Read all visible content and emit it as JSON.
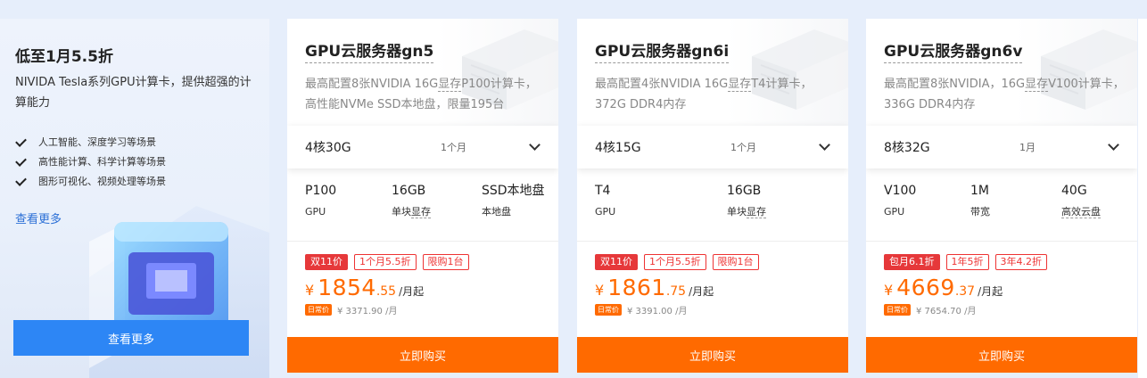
{
  "promo": {
    "title": "低至1月5.5折",
    "description": "NIVIDA Tesla系列GPU计算卡，提供超强的计算能力",
    "features": [
      "人工智能、深度学习等场景",
      "高性能计算、科学计算等场景",
      "图形可视化、视频处理等场景"
    ],
    "more_link": "查看更多",
    "more_button": "查看更多"
  },
  "cards": [
    {
      "title": "GPU云服务器gn5",
      "desc_before": "最高配置8张NVIDIA 16G",
      "desc_dotted": "显存",
      "desc_after": "P100计算卡，高性能NVMe SSD本地盘，限量195台",
      "spec": "4核30G",
      "period": "1个月",
      "specs": [
        {
          "value": "P100",
          "label_plain": "GPU",
          "label_dotted": ""
        },
        {
          "value": "16GB",
          "label_plain": "单块",
          "label_dotted": "显存"
        },
        {
          "value": "SSD本地盘",
          "label_plain": "本地盘",
          "label_dotted": ""
        }
      ],
      "tags": [
        "双11价",
        "1个月5.5折",
        "限购1台"
      ],
      "currency": "¥",
      "price_int": "1854",
      "price_dec": ".55",
      "price_unit": "/月起",
      "orig_badge": "日常价",
      "orig_price": "¥ 3371.90 /月",
      "buy": "立即购买"
    },
    {
      "title": "GPU云服务器gn6i",
      "desc_before": "最高配置4张NVIDIA 16G",
      "desc_dotted": "显存",
      "desc_after": "T4计算卡，372G DDR4内存",
      "spec": "4核15G",
      "period": "1个月",
      "specs": [
        {
          "value": "T4",
          "label_plain": "GPU",
          "label_dotted": ""
        },
        {
          "value": "16GB",
          "label_plain": "单块",
          "label_dotted": "显存"
        }
      ],
      "tags": [
        "双11价",
        "1个月5.5折",
        "限购1台"
      ],
      "currency": "¥",
      "price_int": "1861",
      "price_dec": ".75",
      "price_unit": "/月起",
      "orig_badge": "日常价",
      "orig_price": "¥ 3391.00 /月",
      "buy": "立即购买"
    },
    {
      "title": "GPU云服务器gn6v",
      "desc_before": "最高配置8张NVIDIA，16G",
      "desc_dotted": "显存",
      "desc_after": "V100计算卡，336G DDR4内存",
      "spec": "8核32G",
      "period": "1月",
      "specs": [
        {
          "value": "V100",
          "label_plain": "GPU",
          "label_dotted": ""
        },
        {
          "value": "1M",
          "label_plain": "带宽",
          "label_dotted": ""
        },
        {
          "value": "40G",
          "label_plain": "",
          "label_dotted": "高效云盘"
        }
      ],
      "tags": [
        "包月6.1折",
        "1年5折",
        "3年4.2折"
      ],
      "currency": "¥",
      "price_int": "4669",
      "price_dec": ".37",
      "price_unit": "/月起",
      "orig_badge": "日常价",
      "orig_price": "¥ 7654.70 /月",
      "buy": "立即购买"
    }
  ],
  "colors": {
    "accent_orange": "#ff6a00",
    "accent_blue": "#2d86f5",
    "tag_red": "#e6383a",
    "page_bg": "#e6eefb"
  },
  "icons": [
    "check-icon",
    "chevron-down-icon",
    "gpu-cube-illustration",
    "server-illustration"
  ]
}
